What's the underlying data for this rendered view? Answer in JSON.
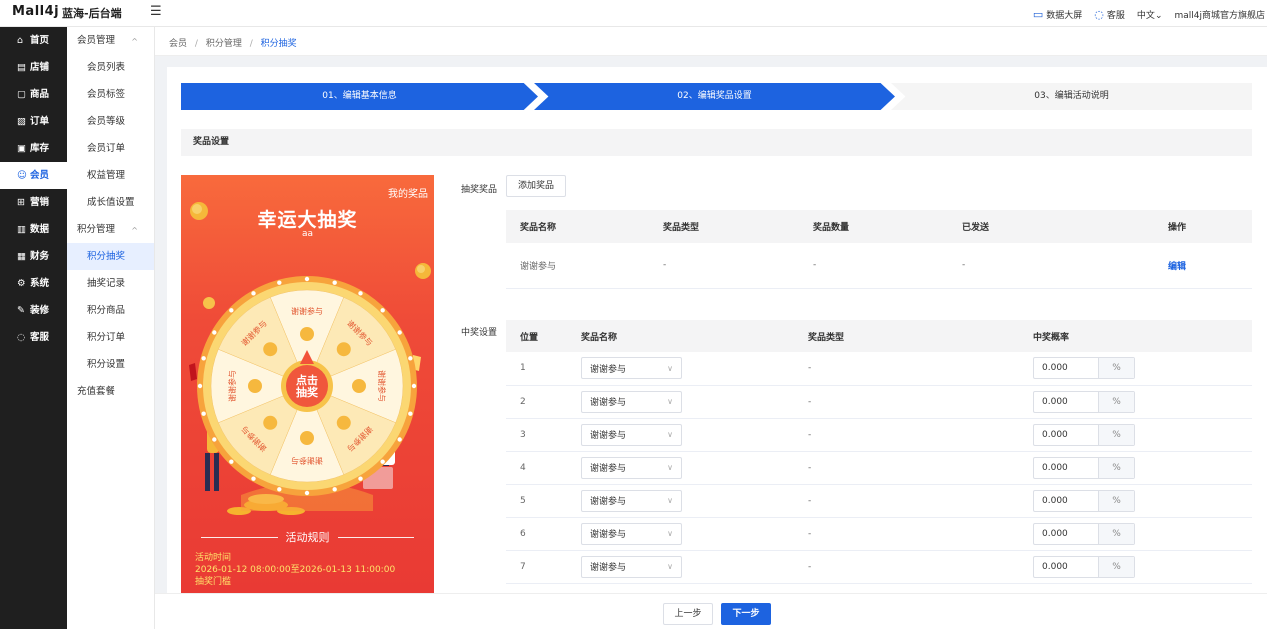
{
  "header": {
    "logo": "Mall4j",
    "shop_name": "蓝海-后台端",
    "data_screen": "数据大屏",
    "service": "客服",
    "language": "中文",
    "store": "mall4j商城官方旗舰店"
  },
  "nav": [
    {
      "icon": "home-icon",
      "label": "首页"
    },
    {
      "icon": "shop-icon",
      "label": "店铺"
    },
    {
      "icon": "goods-icon",
      "label": "商品"
    },
    {
      "icon": "order-icon",
      "label": "订单"
    },
    {
      "icon": "stock-icon",
      "label": "库存"
    },
    {
      "icon": "member-icon",
      "label": "会员"
    },
    {
      "icon": "marketing-icon",
      "label": "营销"
    },
    {
      "icon": "data-icon",
      "label": "数据"
    },
    {
      "icon": "finance-icon",
      "label": "财务"
    },
    {
      "icon": "system-icon",
      "label": "系统"
    },
    {
      "icon": "decorate-icon",
      "label": "装修"
    },
    {
      "icon": "chat-icon",
      "label": "客服"
    }
  ],
  "submenu": {
    "group1": "会员管理",
    "group1_items": [
      "会员列表",
      "会员标签",
      "会员等级",
      "会员订单",
      "权益管理",
      "成长值设置"
    ],
    "group2": "积分管理",
    "group2_items": [
      "积分抽奖",
      "抽奖记录",
      "积分商品",
      "积分订单",
      "积分设置"
    ],
    "recharge": "充值套餐"
  },
  "breadcrumb": {
    "a": "会员",
    "b": "积分管理",
    "c": "积分抽奖",
    "sep": "/"
  },
  "steps": [
    "01、编辑基本信息",
    "02、编辑奖品设置",
    "03、编辑活动说明"
  ],
  "section_title": "奖品设置",
  "preview": {
    "my_prize": "我的奖品",
    "title": "幸运大抽奖",
    "subtitle": "aa",
    "wheel_segments": [
      "谢谢参与",
      "谢谢参与",
      "谢谢参与",
      "谢谢参与",
      "谢谢参与",
      "谢谢参与",
      "谢谢参与",
      "谢谢参与"
    ],
    "center_line1": "点击",
    "center_line2": "抽奖",
    "rules_title": "活动规则",
    "time_label": "活动时间",
    "time_range": "2026-01-12 08:00:00至2026-01-13 11:00:00",
    "threshold_label": "抽奖门槛"
  },
  "prize": {
    "label": "抽奖奖品",
    "add_button": "添加奖品",
    "headers": [
      "奖品名称",
      "奖品类型",
      "奖品数量",
      "已发送",
      "操作"
    ],
    "rows": [
      {
        "name": "谢谢参与",
        "type": "-",
        "qty": "-",
        "sent": "-",
        "action": "编辑"
      }
    ]
  },
  "win": {
    "label": "中奖设置",
    "headers": [
      "位置",
      "奖品名称",
      "奖品类型",
      "中奖概率"
    ],
    "unit": "%",
    "rows": [
      {
        "pos": "1",
        "name": "谢谢参与",
        "type": "-",
        "rate": "0.000"
      },
      {
        "pos": "2",
        "name": "谢谢参与",
        "type": "-",
        "rate": "0.000"
      },
      {
        "pos": "3",
        "name": "谢谢参与",
        "type": "-",
        "rate": "0.000"
      },
      {
        "pos": "4",
        "name": "谢谢参与",
        "type": "-",
        "rate": "0.000"
      },
      {
        "pos": "5",
        "name": "谢谢参与",
        "type": "-",
        "rate": "0.000"
      },
      {
        "pos": "6",
        "name": "谢谢参与",
        "type": "-",
        "rate": "0.000"
      },
      {
        "pos": "7",
        "name": "谢谢参与",
        "type": "-",
        "rate": "0.000"
      }
    ]
  },
  "footer": {
    "prev": "上一步",
    "next": "下一步"
  },
  "colors": {
    "primary": "#1d63e0",
    "sidebar": "#1f1f1f",
    "poster": "#f05033"
  }
}
